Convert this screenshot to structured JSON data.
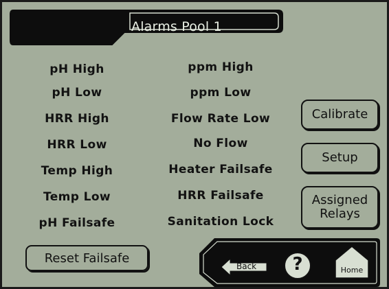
{
  "header": {
    "title": "Alarms Pool 1"
  },
  "alarms_left": [
    "pH High",
    "pH Low",
    "HRR High",
    "HRR Low",
    "Temp High",
    "Temp Low",
    "pH Failsafe"
  ],
  "alarms_right": [
    "ppm High",
    "ppm Low",
    "Flow Rate Low",
    "No Flow",
    "Heater Failsafe",
    "HRR Failsafe",
    "Sanitation Lock"
  ],
  "side_buttons": {
    "calibrate": "Calibrate",
    "setup": "Setup",
    "assigned_relays": "Assigned Relays"
  },
  "reset_button": "Reset Failsafe",
  "nav": {
    "back": "Back",
    "help": "?",
    "home": "Home"
  },
  "colors": {
    "screen_bg": "#a3ad9b",
    "dark": "#111111",
    "title_text": "#e9efe4"
  }
}
